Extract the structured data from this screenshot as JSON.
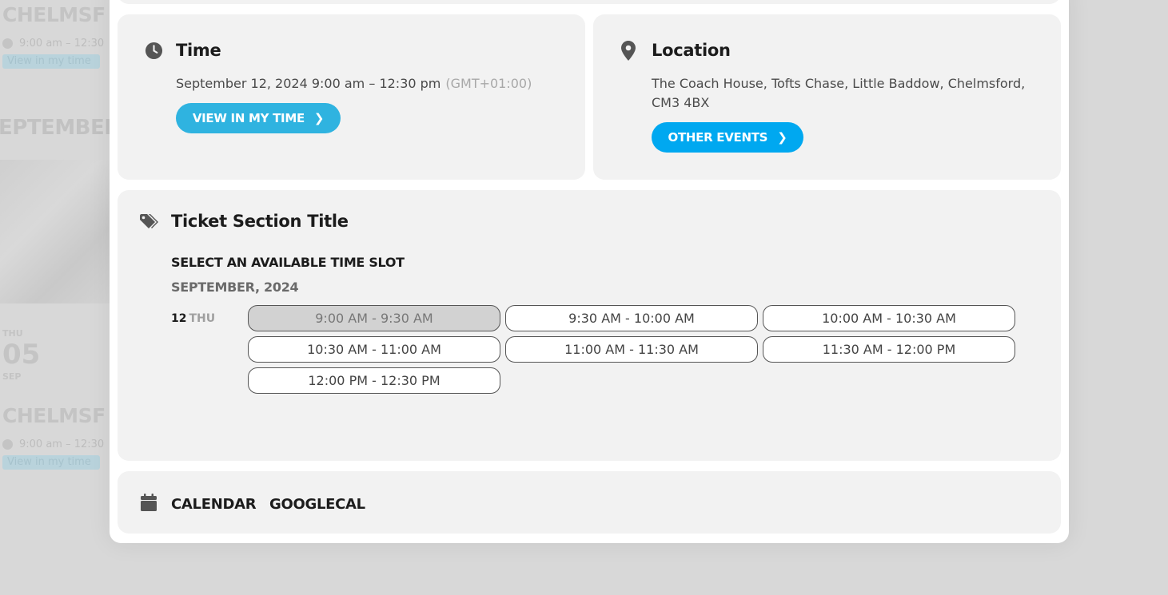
{
  "background_page": {
    "event_title_1": "CHELMSF",
    "event_time_1": "9:00 am – 12:30",
    "view_link_1": "View in my time",
    "month_heading": "EPTEMBER",
    "day_name": "THU",
    "day_number": "05",
    "month_abbr": "SEP",
    "event_title_2": "CHELMSF",
    "event_time_2": "9:00 am – 12:30",
    "view_link_2": "View in my time"
  },
  "time_card": {
    "title": "Time",
    "datetime": "September 12, 2024 9:00 am – 12:30 pm",
    "timezone": "(GMT+01:00)",
    "button_label": "VIEW IN MY TIME",
    "button_color": "#2fb3e0"
  },
  "location_card": {
    "title": "Location",
    "address_line1": "The Coach House, Tofts Chase, Little Baddow, Chelmsford,",
    "address_line2": "CM3 4BX",
    "button_label": "OTHER EVENTS",
    "button_color": "#00a8f0"
  },
  "ticket_card": {
    "title": "Ticket Section Title",
    "select_label": "SELECT AN AVAILABLE TIME SLOT",
    "month_label": "SEPTEMBER, 2024",
    "day_number": "12",
    "day_name": "THU",
    "slots": [
      {
        "label": "9:00 AM - 9:30 AM",
        "selected": true
      },
      {
        "label": "9:30 AM - 10:00 AM",
        "selected": false
      },
      {
        "label": "10:00 AM - 10:30 AM",
        "selected": false
      },
      {
        "label": "10:30 AM - 11:00 AM",
        "selected": false
      },
      {
        "label": "11:00 AM - 11:30 AM",
        "selected": false
      },
      {
        "label": "11:30 AM - 12:00 PM",
        "selected": false
      },
      {
        "label": "12:00 PM - 12:30 PM",
        "selected": false
      }
    ]
  },
  "calendar_card": {
    "calendar_label": "CALENDAR",
    "googlecal_label": "GOOGLECAL"
  },
  "icons": {
    "time": "clock-icon",
    "location": "map-pin-icon",
    "ticket": "tags-icon",
    "calendar": "calendar-icon"
  }
}
